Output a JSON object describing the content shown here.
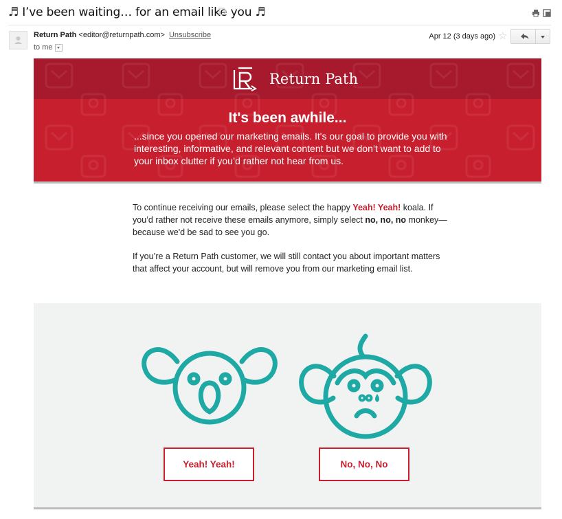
{
  "email": {
    "subject": "♬ I’ve been waiting… for an email like you ♬",
    "sender": {
      "name": "Return Path",
      "address": "<editor@returnpath.com>",
      "unsubscribe": "Unsubscribe"
    },
    "recipient": "to me",
    "date": "Apr 12 (3 days ago)",
    "icons": {
      "label": "label-icon",
      "print": "print-icon",
      "new_window": "new-window-icon",
      "avatar": "avatar-icon",
      "star": "star-icon",
      "reply": "reply-icon",
      "more": "chevron-down-icon"
    }
  },
  "banner": {
    "logo_text": "Return Path",
    "headline": "It's been awhile...",
    "intro": "...since you opened our marketing emails. It's our goal to provide you with interesting, informative, and relevant content but we don’t want to add to your inbox clutter if you’d rather not hear from us."
  },
  "body": {
    "p1_a": "To continue receiving our emails, please select the happy ",
    "p1_yes": "Yeah! Yeah!",
    "p1_b": " koala. If you’d rather not receive these emails anymore, simply select ",
    "p1_no": "no, no, no",
    "p1_c": " monkey—because we'd be sad to see you go.",
    "p2": "If you’re a Return Path customer, we will still contact you about important matters that affect your account, but will remove you from our marketing email list."
  },
  "choices": {
    "yes_label": "Yeah! Yeah!",
    "no_label": "No, No, No"
  },
  "colors": {
    "brand_red": "#c71f2e",
    "brand_dark_red": "#a7192c",
    "teal": "#1fa9a4",
    "panel_gray": "#f1f2f2"
  }
}
